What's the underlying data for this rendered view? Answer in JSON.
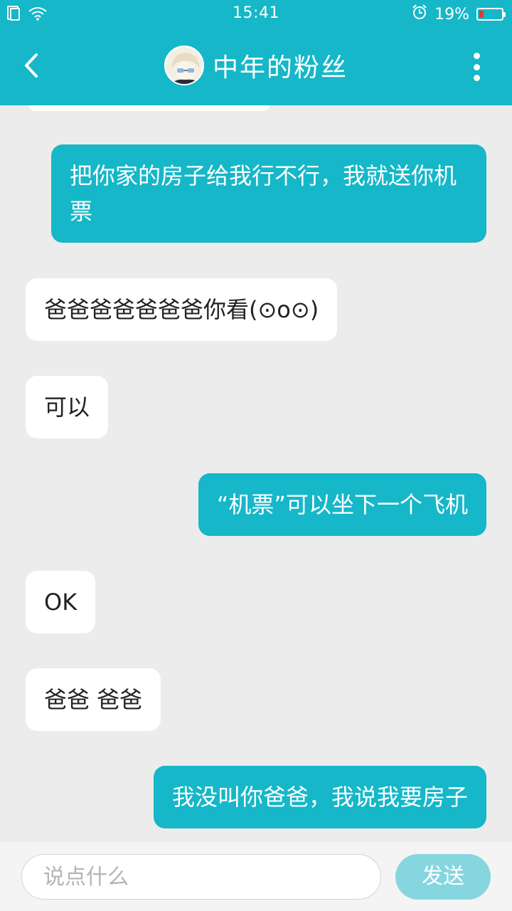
{
  "status_bar": {
    "time": "15:41",
    "battery_percent": "19%",
    "battery_level": 0.19,
    "icons": [
      "sim-icon",
      "wifi-icon",
      "alarm-icon",
      "battery-icon"
    ]
  },
  "header": {
    "title": "中年的粉丝",
    "back_icon": "chevron-left-icon",
    "more_icon": "more-vertical-icon"
  },
  "colors": {
    "accent": "#15b7c8",
    "background": "#ececec",
    "incoming_bubble": "#ffffff",
    "send_disabled": "#86d6df"
  },
  "messages": [
    {
      "direction": "out",
      "text": "把你家的房子给我行不行，我就送你机票"
    },
    {
      "direction": "in",
      "text": "爸爸爸爸爸爸爸你看(⊙o⊙)"
    },
    {
      "direction": "in",
      "text": "可以"
    },
    {
      "direction": "out",
      "text": "“机票”可以坐下一个飞机"
    },
    {
      "direction": "in",
      "text": "OK"
    },
    {
      "direction": "in",
      "text": "爸爸 爸爸"
    },
    {
      "direction": "out",
      "text": "我没叫你爸爸，我说我要房子"
    }
  ],
  "composer": {
    "placeholder": "说点什么",
    "send_label": "发送"
  }
}
